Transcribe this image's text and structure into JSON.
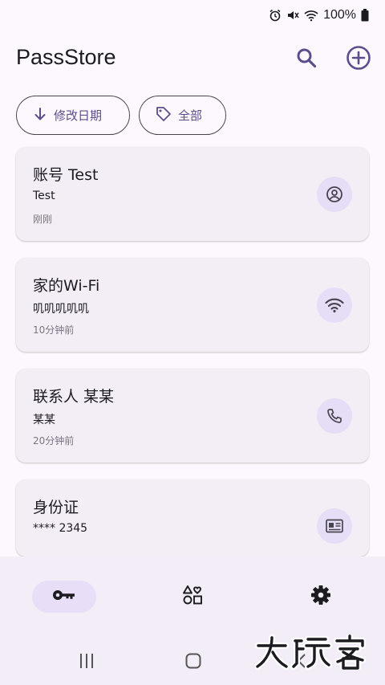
{
  "status_bar": {
    "battery_percent": "100%",
    "icons": [
      "alarm-icon",
      "mute-icon",
      "wifi-icon",
      "battery-icon"
    ]
  },
  "app": {
    "title": "PassStore"
  },
  "toolbar": {
    "search_icon": "search-icon",
    "add_icon": "add-circle-icon"
  },
  "filters": {
    "sort_label": "修改日期",
    "sort_icon": "arrow-down-icon",
    "category_label": "全部",
    "category_icon": "tag-icon"
  },
  "entries": [
    {
      "title": "账号 Test",
      "subtitle": "Test",
      "time": "刚刚",
      "icon": "account-icon"
    },
    {
      "title": "家的Wi-Fi",
      "subtitle": "叽叽叽叽叽",
      "time": "10分钟前",
      "icon": "wifi-icon"
    },
    {
      "title": "联系人 某某",
      "subtitle": "某某",
      "time": "20分钟前",
      "icon": "phone-icon"
    },
    {
      "title": "身份证",
      "subtitle": "**** 2345",
      "time": "",
      "icon": "id-card-icon"
    }
  ],
  "bottom_nav": {
    "items": [
      {
        "icon": "key-icon",
        "active": true
      },
      {
        "icon": "categories-icon",
        "active": false
      },
      {
        "icon": "settings-gear-icon",
        "active": false
      }
    ]
  },
  "system_nav": {
    "items": [
      "recent-apps-icon",
      "home-icon",
      "back-icon"
    ]
  },
  "watermark": {
    "text": "大玩客"
  },
  "colors": {
    "background": "#fdf8fd",
    "accent": "#5b4e8c",
    "card": "#f3eef6",
    "icon_container": "#e6ddf6",
    "nav_active": "#e8def8"
  }
}
